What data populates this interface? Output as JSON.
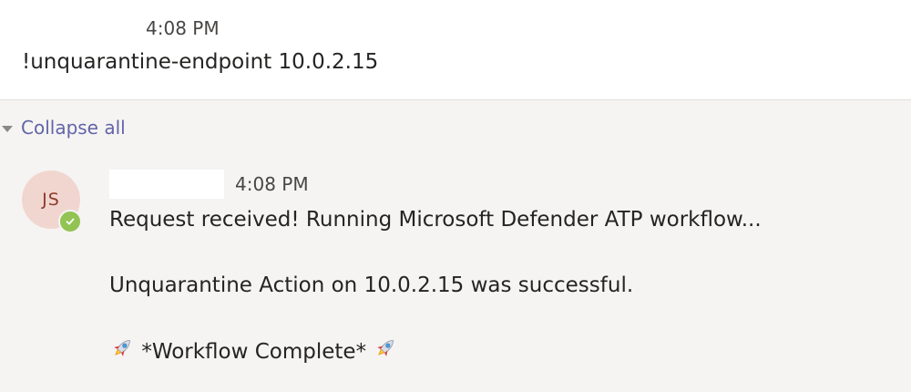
{
  "top_message": {
    "timestamp": "4:08 PM",
    "text": "!unquarantine-endpoint 10.0.2.15"
  },
  "thread": {
    "collapse_label": "Collapse all"
  },
  "reply": {
    "avatar_initials": "JS",
    "presence_status": "available",
    "timestamp": "4:08 PM",
    "lines": [
      "Request received! Running Microsoft Defender ATP workflow...",
      "Unquarantine Action on 10.0.2.15 was successful.",
      "*Workflow Complete*"
    ]
  },
  "colors": {
    "link": "#6264a7",
    "presence_available": "#92c353",
    "avatar_bg": "#f1d6d0",
    "avatar_text": "#8d3a2a"
  },
  "icons": {
    "presence": "check-icon",
    "rocket": "rocket-icon",
    "collapse": "caret-down-icon"
  }
}
